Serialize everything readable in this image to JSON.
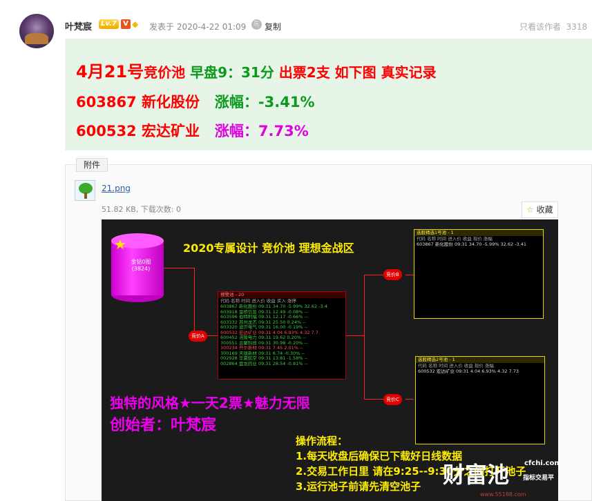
{
  "author": {
    "name": "叶梵宸",
    "level": "Lv.7",
    "v_badge": "V",
    "diamond": "◆"
  },
  "post": {
    "posted_at": "发表于 2020-4-22 01:09",
    "copy_label": "复制",
    "view_author_label": "只看该作者",
    "floor_id": "3318"
  },
  "content": {
    "line1_a": "4月21号",
    "line1_b": "竞价池",
    "line1_c": " 早盘9：31分 ",
    "line1_d": "出票2支 如下图 真实记录",
    "stock1_code": "603867 新化股份",
    "stock1_label": "涨幅：",
    "stock1_change": "-3.41%",
    "stock2_code": "600532 宏达矿业",
    "stock2_label": "涨幅：",
    "stock2_change": "7.73%"
  },
  "attachment": {
    "tab_label": "附件",
    "filename": "21.png",
    "meta": "51.82 KB, 下载次数: 0",
    "fav_label": "收藏",
    "fav_icon": "star-icon"
  },
  "image": {
    "title": "2020专属设计 竞价池 理想金战区",
    "cyl_label": "金钻0图\n(3824)",
    "main_win_title": "预警池 - 20",
    "main_win_header": "代码   名称     时间  进入价  收益   买入  涨停",
    "main_rows": [
      "603867 新化股份 09:31 34.70 -5.99% 32.62 -3.4",
      "603918 金桥信息 09:31 12.49 -0.08%  --",
      "603596 伯特利福 09:31 12.17 -0.66%  --",
      "603332 苏州龙杰 09:31 25.50  0.24%  --",
      "603320 迪贝电气 09:31 16.00 -0.19%  --",
      "600532 宏达矿业 09:31  4.04  6.93%  4.32  7.7",
      "600452 涪陵电力 09:31 19.62  0.20%  --",
      "300551 古鳌科技 09:31 30.98 -0.20%  --",
      "300234 开尔新材 09:31  7.45  2.01%  --",
      "300169 天晟新材 09:31  6.74 -0.30%  --",
      "002928 华夏航空 09:31 13.81 -1.58%  --",
      "002864 盘龙药业 09:31 28.54 -0.81%  --"
    ],
    "win_b_title": "选股精选1号池 - 1",
    "win_b_header": "代码   名称   时间 进入价 收益  现价  涨幅",
    "win_b_row": "603867 新化股份 09:31 34.70 -5.99% 32.62 -3.41",
    "win_c_title": "选股精选2号池 - 1",
    "win_c_header": "代码   名称   时间 进入价 收益  现价  涨幅",
    "win_c_row": "600532 宏达矿业 09:31 4.04 6.93% 4.32 7.73",
    "pill_a": "竞价A",
    "pill_b": "竞价B",
    "pill_c": "竞价C",
    "slogan1": "独特的风格★一天2票★魅力无限",
    "slogan2": "创始者：叶梵宸",
    "ops_title": "操作流程：",
    "ops_1": "1.每天收盘后确保已下载好日线数据",
    "ops_2": "2.交易工作日里 请在9:25--9:30分之间打开池子",
    "ops_3": "3.运行池子前请先清空池子",
    "watermark": "财富池",
    "watermark_small": "cfchi.com",
    "watermark_sub": "指标交易平",
    "watermark_bottom": "www.55188.com"
  },
  "colors": {
    "red": "#ff0000",
    "green": "#0a9a1d",
    "magenta": "#e000e0",
    "greenbox": "#e6f5e8"
  }
}
